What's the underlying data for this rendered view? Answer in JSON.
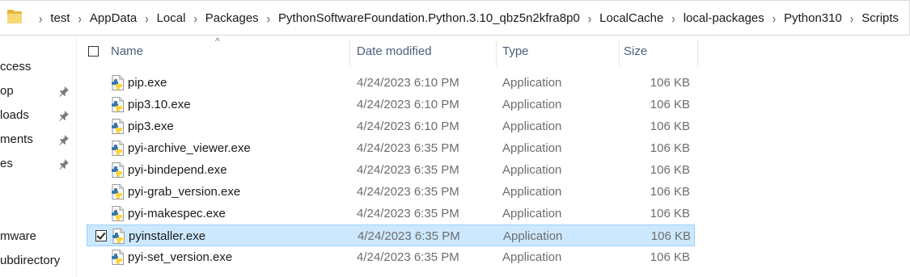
{
  "address_bar": {
    "crumbs": [
      "test",
      "AppData",
      "Local",
      "Packages",
      "PythonSoftwareFoundation.Python.3.10_qbz5n2kfra8p0",
      "LocalCache",
      "local-packages",
      "Python310",
      "Scripts"
    ]
  },
  "nav": {
    "items": [
      {
        "label": "ccess",
        "pinned": false
      },
      {
        "label": "op",
        "pinned": true
      },
      {
        "label": "loads",
        "pinned": true
      },
      {
        "label": "ments",
        "pinned": true
      },
      {
        "label": "es",
        "pinned": true
      },
      {
        "label": "mware",
        "pinned": false
      },
      {
        "label": "ubdirectory",
        "pinned": false
      }
    ]
  },
  "columns": {
    "name": "Name",
    "date": "Date modified",
    "type": "Type",
    "size": "Size"
  },
  "files": [
    {
      "name": "pip.exe",
      "date": "4/24/2023 6:10 PM",
      "type": "Application",
      "size": "106 KB",
      "selected": false
    },
    {
      "name": "pip3.10.exe",
      "date": "4/24/2023 6:10 PM",
      "type": "Application",
      "size": "106 KB",
      "selected": false
    },
    {
      "name": "pip3.exe",
      "date": "4/24/2023 6:10 PM",
      "type": "Application",
      "size": "106 KB",
      "selected": false
    },
    {
      "name": "pyi-archive_viewer.exe",
      "date": "4/24/2023 6:35 PM",
      "type": "Application",
      "size": "106 KB",
      "selected": false
    },
    {
      "name": "pyi-bindepend.exe",
      "date": "4/24/2023 6:35 PM",
      "type": "Application",
      "size": "106 KB",
      "selected": false
    },
    {
      "name": "pyi-grab_version.exe",
      "date": "4/24/2023 6:35 PM",
      "type": "Application",
      "size": "106 KB",
      "selected": false
    },
    {
      "name": "pyi-makespec.exe",
      "date": "4/24/2023 6:35 PM",
      "type": "Application",
      "size": "106 KB",
      "selected": false
    },
    {
      "name": "pyinstaller.exe",
      "date": "4/24/2023 6:35 PM",
      "type": "Application",
      "size": "106 KB",
      "selected": true
    },
    {
      "name": "pyi-set_version.exe",
      "date": "4/24/2023 6:35 PM",
      "type": "Application",
      "size": "106 KB",
      "selected": false
    }
  ],
  "icons": {
    "folder": "folder-icon",
    "pin": "pin-icon",
    "file": "python-exe-icon",
    "sort": "sort-up-icon"
  },
  "colors": {
    "selection_bg": "#cce8ff",
    "selection_border": "#99d1ff",
    "header_text": "#4c607a"
  }
}
